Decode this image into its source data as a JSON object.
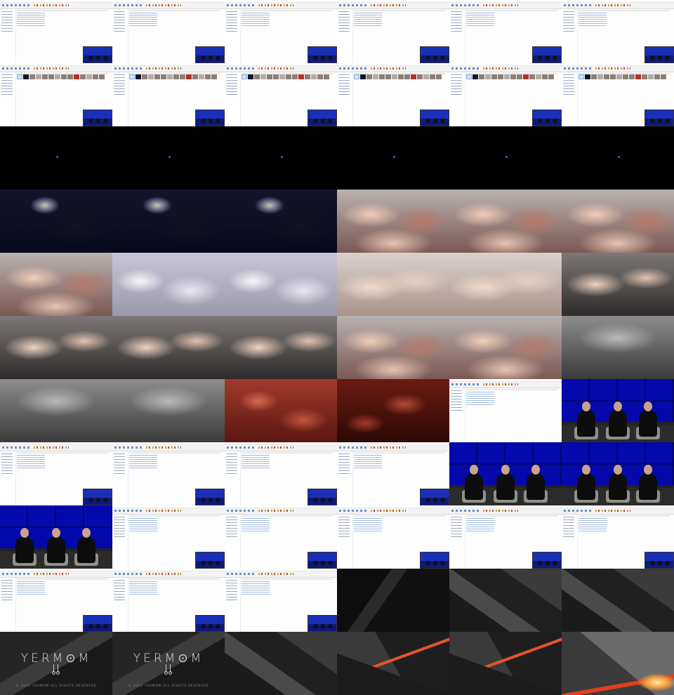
{
  "contact_sheet": {
    "columns": 6,
    "rows": 11,
    "frames": [
      "explorer",
      "explorer",
      "explorer",
      "explorer",
      "explorer",
      "explorer",
      "explorer-alt",
      "explorer-alt",
      "explorer-alt",
      "explorer-alt",
      "explorer-alt",
      "explorer-alt",
      "space",
      "space",
      "space",
      "space",
      "space",
      "space",
      "cloud-night",
      "cloud-night",
      "cloud-night",
      "cloud-peach",
      "cloud-peach",
      "cloud-peach",
      "cloud-peach",
      "cloud-white",
      "cloud-white",
      "cloud-cream",
      "cloud-cream",
      "cloud-broken",
      "cloud-broken",
      "cloud-broken",
      "cloud-broken",
      "cloud-peach",
      "cloud-peach",
      "cloud-grey",
      "cloud-grey",
      "cloud-grey",
      "cloud-red",
      "cloud-darkred",
      "explorer-plain",
      "stage",
      "explorer",
      "explorer",
      "explorer",
      "explorer",
      "stage",
      "stage",
      "stage",
      "explorer",
      "explorer",
      "explorer",
      "explorer",
      "explorer",
      "explorer",
      "explorer",
      "explorer",
      "shard-dark",
      "shard-mid",
      "shard-mid",
      "logo",
      "logo",
      "shard-mid",
      "shard-orange",
      "shard-orange",
      "shard-fire"
    ],
    "logo_word": "YERM⊙M",
    "logo_caption": "© 2020 YERMOM ALL RIGHTS RESERVED"
  },
  "colors": {
    "stage_blue": "#1d2fd0",
    "explorer_background": "#fdfdfd",
    "fire_orange": "#f39b3a"
  }
}
